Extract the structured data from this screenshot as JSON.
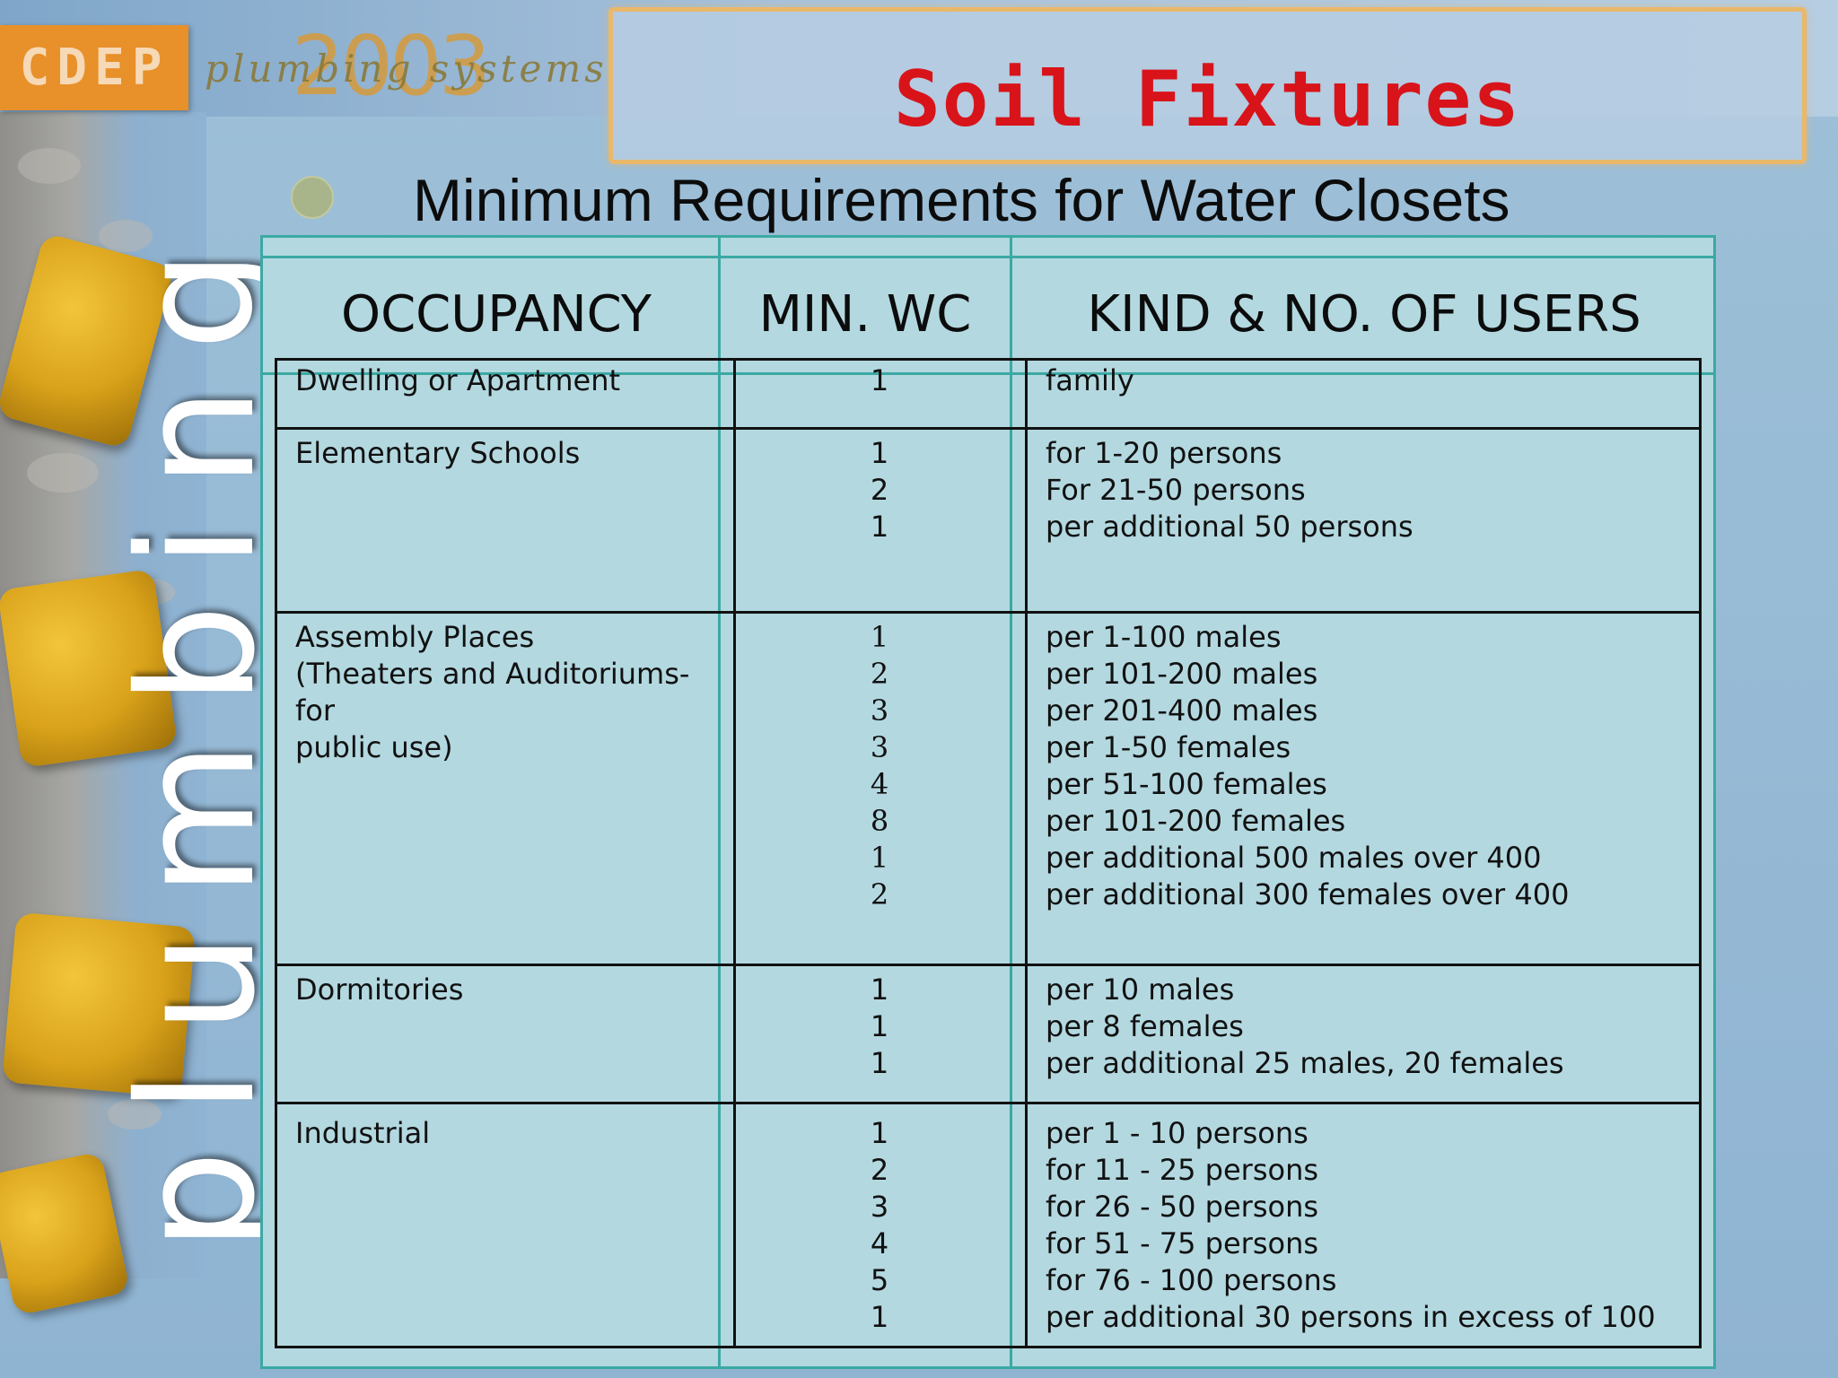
{
  "logo": {
    "text": "CDEP",
    "year": "2003",
    "tagline": "plumbing systems"
  },
  "side_word": "plumbing",
  "title": "Soil Fixtures",
  "subtitle": "Minimum Requirements for Water Closets",
  "table": {
    "headers": {
      "occupancy": "OCCUPANCY",
      "min_wc": "MIN. WC",
      "users": "KIND & NO. OF USERS"
    },
    "rows": [
      {
        "occupancy": "Dwelling or Apartment",
        "min_wc": "1",
        "users": "family"
      },
      {
        "occupancy": "Elementary Schools",
        "min_wc": "1\n2\n1",
        "users": "for 1-20 persons\nFor 21-50 persons\nper additional 50 persons"
      },
      {
        "occupancy": "Assembly Places\n(Theaters and Auditoriums- for\npublic use)",
        "min_wc": "1\n2\n3\n3\n4\n8\n1\n2",
        "users": "per 1-100 males\nper 101-200 males\nper 201-400 males\nper 1-50 females\nper 51-100 females\nper 101-200 females\nper additional 500 males over 400\nper additional 300 females over 400"
      },
      {
        "occupancy": "Dormitories",
        "min_wc": "1\n1\n1",
        "users": "per 10 males\nper 8 females\nper additional 25 males, 20 females"
      },
      {
        "occupancy": "Industrial",
        "min_wc": "1\n2\n3\n4\n5\n1",
        "users": "per 1 - 10 persons\nfor 11 - 25 persons\nfor 26 - 50 persons\nfor 51 - 75 persons\nfor 76 - 100 persons\nper additional 30 persons in excess of 100"
      }
    ]
  },
  "colors": {
    "title": "#d8141a",
    "accent_border": "#e9b86a",
    "table_bg": "#b3d8e0",
    "grid_teal": "#3ba9a3"
  }
}
